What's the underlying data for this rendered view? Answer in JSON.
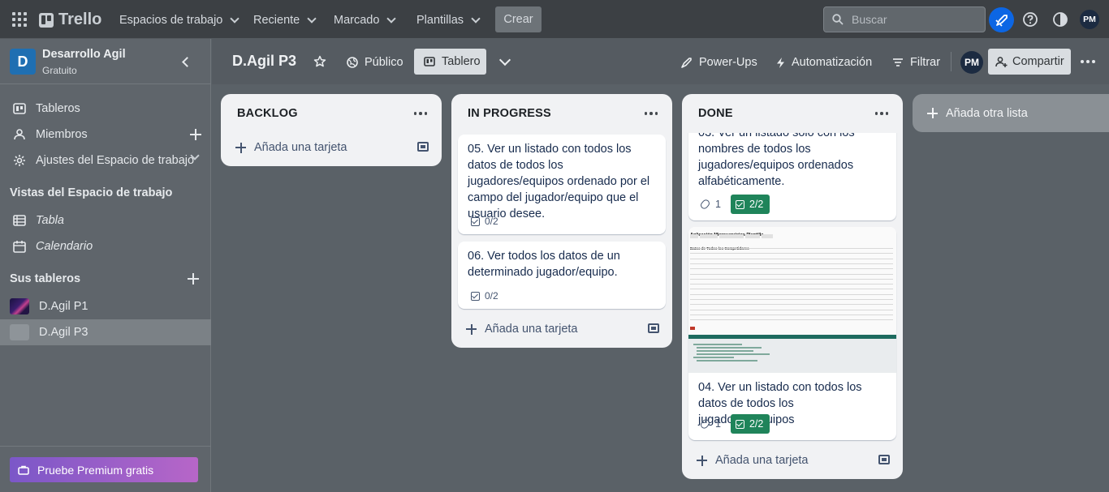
{
  "topbar": {
    "logo": "Trello",
    "nav": [
      {
        "label": "Espacios de trabajo"
      },
      {
        "label": "Reciente"
      },
      {
        "label": "Marcado"
      },
      {
        "label": "Plantillas"
      }
    ],
    "create_label": "Crear",
    "search_placeholder": "Buscar",
    "user_initials": "PM"
  },
  "sidebar": {
    "workspace_initial": "D",
    "workspace_name": "Desarrollo Agil",
    "workspace_plan": "Gratuito",
    "items": [
      {
        "label": "Tableros",
        "icon": "board-icon"
      },
      {
        "label": "Miembros",
        "icon": "person-icon"
      },
      {
        "label": "Ajustes del Espacio de trabajo",
        "icon": "gear-icon"
      }
    ],
    "views_heading": "Vistas del Espacio de trabajo",
    "views": [
      {
        "label": "Tabla",
        "icon": "table-icon"
      },
      {
        "label": "Calendario",
        "icon": "calendar-icon"
      }
    ],
    "boards_heading": "Sus tableros",
    "boards": [
      {
        "label": "D.Agil P1"
      },
      {
        "label": "D.Agil P3"
      }
    ],
    "premium_label": "Pruebe Premium gratis"
  },
  "board": {
    "title": "D.Agil P3",
    "visibility": "Público",
    "view": "Tablero",
    "powerups": "Power-Ups",
    "automation": "Automatización",
    "filter": "Filtrar",
    "share": "Compartir",
    "member_initials": "PM"
  },
  "lists": [
    {
      "title": "BACKLOG",
      "add_card": "Añada una tarjeta",
      "cards": []
    },
    {
      "title": "IN PROGRESS",
      "add_card": "Añada una tarjeta",
      "cards": [
        {
          "text": "05. Ver un listado con todos los datos de todos los jugadores/equipos ordenado por el campo del jugador/equipo que el usuario desee.",
          "checklist": "0/2"
        },
        {
          "text": "06. Ver todos los datos de un determinado jugador/equipo.",
          "checklist": "0/2"
        }
      ]
    },
    {
      "title": "DONE",
      "add_card": "Añada una tarjeta",
      "cards": [
        {
          "text": "03. Ver un listado solo con los nombres de todos los jugadores/equipos ordenados alfabéticamente.",
          "attachments": "1",
          "checklist": "2/2"
        },
        {
          "text": "04. Ver un listado con todos los datos de todos los jugadores/equipos",
          "attachments": "1",
          "checklist": "2/2",
          "cover_title": "Aplicación Microservicios Plantilla",
          "cover_subtitle": "Datos de Todos los Competidores"
        }
      ]
    }
  ],
  "add_list": "Añada otra lista",
  "colors": {
    "topbar": "#3c4044",
    "board_bg": "#5a6167",
    "accent": "#0c66e4",
    "done_badge": "#1f845a",
    "premium_from": "#7b57c8",
    "premium_to": "#b766c8"
  }
}
